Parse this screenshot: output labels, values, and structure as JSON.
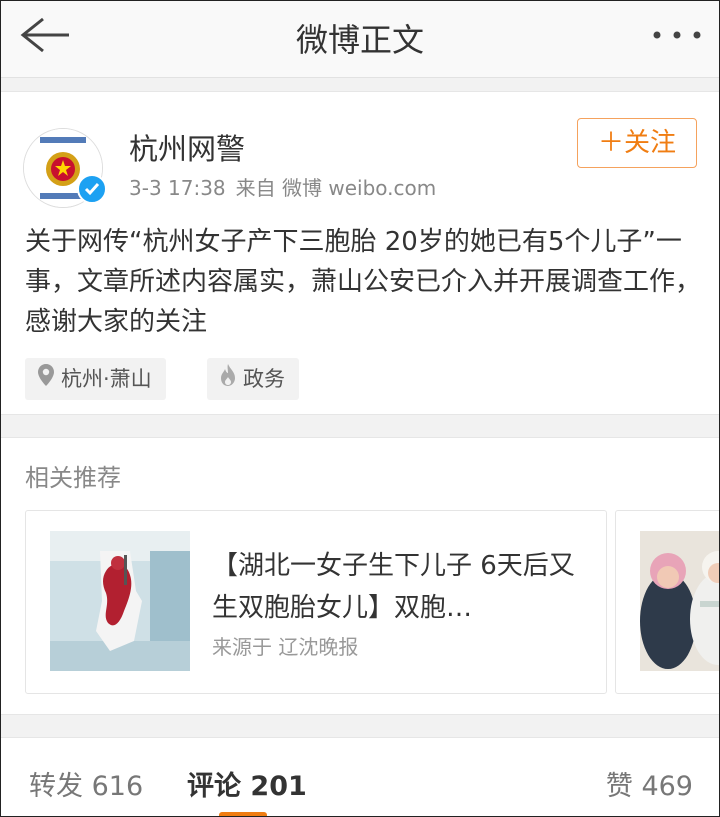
{
  "header": {
    "title": "微博正文"
  },
  "post": {
    "username": "杭州网警",
    "time": "3-3 17:38",
    "source": "来自 微博 weibo.com",
    "follow_label": "关注",
    "content": "关于网传“杭州女子产下三胞胎 20岁的她已有5个儿子”一事，文章所述内容属实，萧山公安已介入并开展调查工作，感谢大家的关注",
    "tags": [
      {
        "label": "杭州·萧山",
        "icon": "location-icon"
      },
      {
        "label": "政务",
        "icon": "flame-icon"
      }
    ]
  },
  "related": {
    "title": "相关推荐",
    "cards": [
      {
        "title": "【湖北一女子生下儿子 6天后又生双胞胎女儿】双胞…",
        "source": "来源于 辽沈晚报"
      }
    ]
  },
  "tabs": {
    "reposts_label": "转发",
    "reposts_count": "616",
    "comments_label": "评论",
    "comments_count": "201",
    "likes_label": "赞",
    "likes_count": "469"
  },
  "colors": {
    "accent": "#f07d12",
    "verified": "#1da1f2"
  }
}
